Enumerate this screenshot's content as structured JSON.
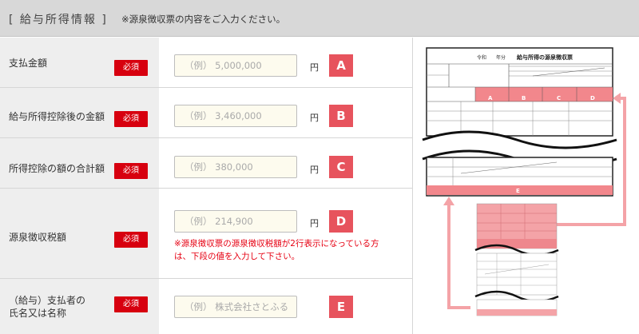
{
  "header": {
    "title": "[ 給与所得情報 ]",
    "note": "※源泉徴収票の内容をご入力ください。"
  },
  "required_label": "必須",
  "fields": [
    {
      "label": "支払金額",
      "placeholder": "（例） 5,000,000",
      "unit": "円",
      "badge": "A"
    },
    {
      "label": "給与所得控除後の金額",
      "placeholder": "（例） 3,460,000",
      "unit": "円",
      "badge": "B"
    },
    {
      "label": "所得控除の額の合計額",
      "placeholder": "（例） 380,000",
      "unit": "円",
      "badge": "C"
    },
    {
      "label": "源泉徴収税額",
      "placeholder": "（例） 214,900",
      "unit": "円",
      "badge": "D",
      "warning_line1": "※源泉徴収票の源泉徴収税額が2行表示になっている方",
      "warning_line2": "は、下段の値を入力して下さい。"
    },
    {
      "label_line1": "（給与）支払者の",
      "label_line2": "氏名又は名称",
      "placeholder": "（例） 株式会社さとふる",
      "badge": "E"
    }
  ],
  "illustration": {
    "form_title": "給与所得の源泉徴収票",
    "era_label": "令和",
    "year_label": "年分",
    "markers": [
      "A",
      "B",
      "C",
      "D",
      "E"
    ],
    "highlight_color": "#f2878c",
    "arrow_color": "#f4a3a7"
  }
}
